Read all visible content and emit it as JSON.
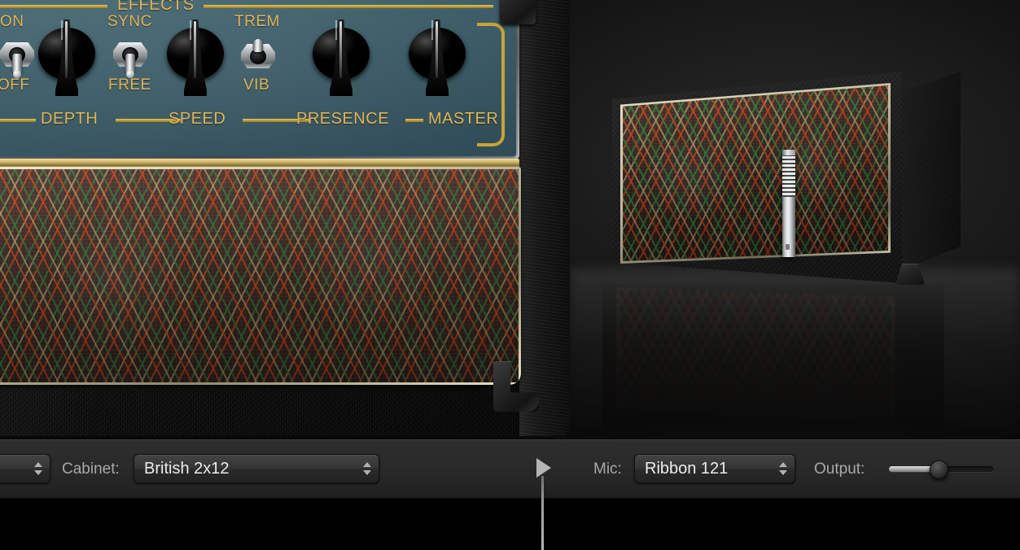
{
  "amp": {
    "panel": {
      "section_title": "EFFECTS",
      "switches": [
        {
          "name": "power-switch",
          "top_label": "ON",
          "bottom_label": "OFF",
          "position": "down"
        },
        {
          "name": "sync-switch",
          "top_label": "SYNC",
          "bottom_label": "FREE",
          "position": "down"
        },
        {
          "name": "trem-vib-switch",
          "top_label": "TREM",
          "bottom_label": "VIB",
          "position": "up"
        }
      ],
      "knobs": [
        {
          "name": "depth-knob",
          "label": "DEPTH"
        },
        {
          "name": "speed-knob",
          "label": "SPEED"
        },
        {
          "name": "presence-knob",
          "label": "PRESENCE"
        },
        {
          "name": "master-knob",
          "label": "MASTER"
        }
      ]
    }
  },
  "cabinet_view": {
    "mic_name": "ribbon-microphone",
    "cabinet_name": "speaker-cabinet-2x12"
  },
  "toolbar": {
    "amp_popup": {
      "value": "",
      "stepper_icon": "chevron-up-down-icon"
    },
    "cabinet_label": "Cabinet:",
    "cabinet_popup": {
      "value": "British 2x12",
      "stepper_icon": "chevron-up-down-icon"
    },
    "mic_label": "Mic:",
    "mic_popup": {
      "value": "Ribbon 121",
      "stepper_icon": "chevron-up-down-icon"
    },
    "output_label": "Output:",
    "output_slider": {
      "value_percent": 48
    }
  },
  "callout": {
    "icon": "triangle-pointer-icon"
  },
  "colors": {
    "panel_teal": "#3d5d68",
    "gold": "#e0b556",
    "grille_red": "#c44820",
    "grille_green": "#347c42",
    "grille_tan": "#b6a06c",
    "toolbar_bg": "#2a2a2a",
    "text_dim": "#a8a8a8",
    "text_bright": "#ededed"
  }
}
